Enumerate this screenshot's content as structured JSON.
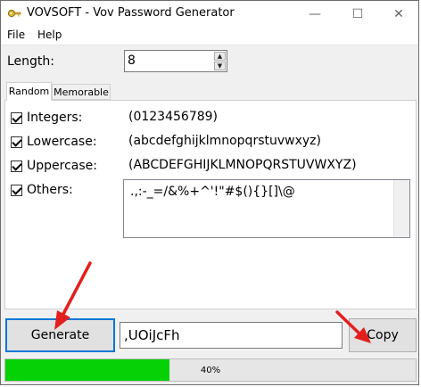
{
  "window": {
    "title": "VOVSOFT - Vov Password Generator",
    "controls": {
      "minimize": "—",
      "maximize": "☐",
      "close": "✕"
    }
  },
  "menu": {
    "file": "File",
    "help": "Help"
  },
  "length": {
    "label": "Length:",
    "value": "8"
  },
  "tabs": [
    {
      "label": "Random",
      "active": true
    },
    {
      "label": "Memorable",
      "active": false
    }
  ],
  "options": [
    {
      "label": "Integers:",
      "checked": true,
      "chars": "(0123456789)"
    },
    {
      "label": "Lowercase:",
      "checked": true,
      "chars": "(abcdefghijklmnopqrstuvwxyz)"
    },
    {
      "label": "Uppercase:",
      "checked": true,
      "chars": "(ABCDEFGHIJKLMNOPQRSTUVWXYZ)"
    },
    {
      "label": "Others:",
      "checked": true,
      "chars": ".,:-_=/&%+^'!\"#$(){}[]\\@"
    }
  ],
  "actions": {
    "generate_label": "Generate",
    "password_value": ",UOiJcFh",
    "copy_label": "Copy"
  },
  "strength": {
    "percent_text": "40%",
    "fraction": 0.4,
    "color": "#06d006"
  },
  "icons": [
    "key-icon",
    "minimize-icon",
    "maximize-icon",
    "close-icon",
    "spin-up-icon",
    "spin-down-icon",
    "red-arrow-icon"
  ],
  "colors": {
    "accent": "#0078d7",
    "annotation_arrow": "#e41e1e"
  }
}
